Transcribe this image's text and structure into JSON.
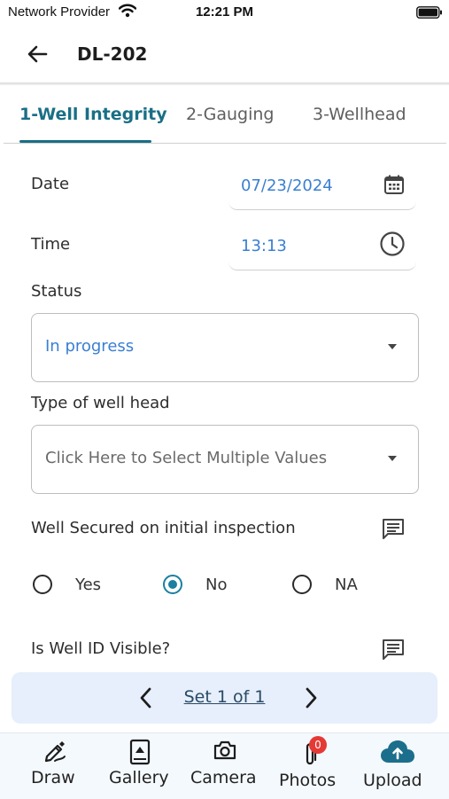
{
  "status_bar": {
    "carrier": "Network Provider",
    "time": "12:21 PM"
  },
  "header": {
    "title": "DL-202"
  },
  "tabs": [
    {
      "label": "1-Well Integrity",
      "active": true
    },
    {
      "label": "2-Gauging",
      "active": false
    },
    {
      "label": "3-Wellhead",
      "active": false
    }
  ],
  "form": {
    "date": {
      "label": "Date",
      "value": "07/23/2024",
      "icon": "calendar-icon"
    },
    "time": {
      "label": "Time",
      "value": "13:13",
      "icon": "clock-icon"
    },
    "status": {
      "label": "Status",
      "value": "In progress"
    },
    "well_head_type": {
      "label": "Type of well head",
      "placeholder": "Click Here to Select Multiple Values"
    },
    "well_secured": {
      "label": "Well Secured on initial inspection",
      "options": [
        "Yes",
        "No",
        "NA"
      ],
      "selected": "No"
    },
    "well_id_visible": {
      "label": "Is Well ID Visible?"
    }
  },
  "pager": {
    "label": "Set 1 of 1"
  },
  "bottom_nav": {
    "draw": "Draw",
    "gallery": "Gallery",
    "camera": "Camera",
    "photos": "Photos",
    "photos_badge": "0",
    "upload": "Upload"
  },
  "colors": {
    "accent": "#1a6f86",
    "value_text": "#3a7fd1",
    "upload_icon": "#1b6f8c",
    "badge": "#e53935",
    "pager_bg": "#e6effb"
  }
}
